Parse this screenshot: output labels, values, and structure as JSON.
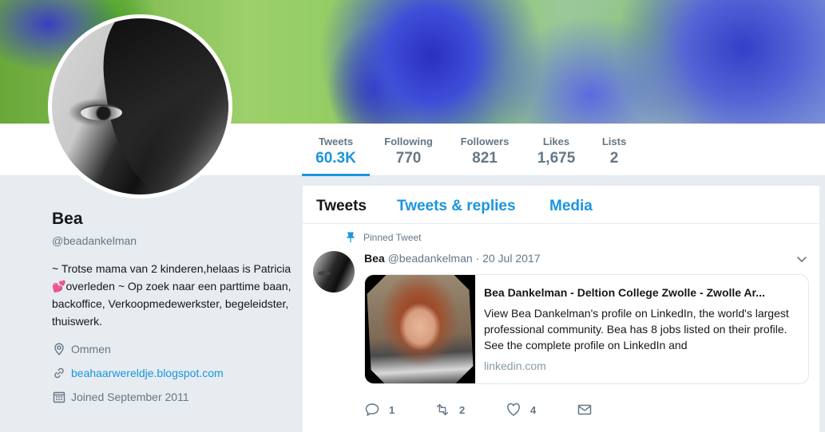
{
  "nav": {
    "stats": [
      {
        "label": "Tweets",
        "value": "60.3K"
      },
      {
        "label": "Following",
        "value": "770"
      },
      {
        "label": "Followers",
        "value": "821"
      },
      {
        "label": "Likes",
        "value": "1,675"
      },
      {
        "label": "Lists",
        "value": "2"
      }
    ]
  },
  "profile": {
    "name": "Bea",
    "handle": "@beadankelman",
    "bio_before": "~ Trotse mama van 2 kinderen,helaas is Patricia ",
    "bio_emoji": "💕",
    "bio_after": "overleden ~ Op zoek naar een parttime baan, backoffice, Verkoopmedewerkster, begeleidster, thuiswerk.",
    "location": "Ommen",
    "website": "beahaarwereldje.blogspot.com",
    "joined": "Joined September 2011"
  },
  "timeline": {
    "tabs": [
      "Tweets",
      "Tweets & replies",
      "Media"
    ],
    "pinned_label": "Pinned Tweet",
    "tweet": {
      "name": "Bea",
      "handle": "@beadankelman",
      "date": "· 20 Jul 2017",
      "card": {
        "title": "Bea Dankelman - Deltion College Zwolle - Zwolle Ar...",
        "description": "View Bea Dankelman's profile on LinkedIn, the world's largest professional community. Bea has 8 jobs listed on their profile. See the complete profile on LinkedIn and",
        "domain": "linkedin.com"
      },
      "actions": {
        "replies": "1",
        "retweets": "2",
        "likes": "4"
      }
    }
  },
  "icons": {
    "pin": "pin-icon",
    "location": "location-icon",
    "link": "link-icon",
    "calendar": "calendar-icon",
    "reply": "reply-icon",
    "retweet": "retweet-icon",
    "like": "heart-icon",
    "message": "envelope-icon",
    "caret": "chevron-down-icon"
  },
  "colors": {
    "accent": "#1b95e0",
    "muted": "#657786",
    "background": "#e6ecf0"
  }
}
